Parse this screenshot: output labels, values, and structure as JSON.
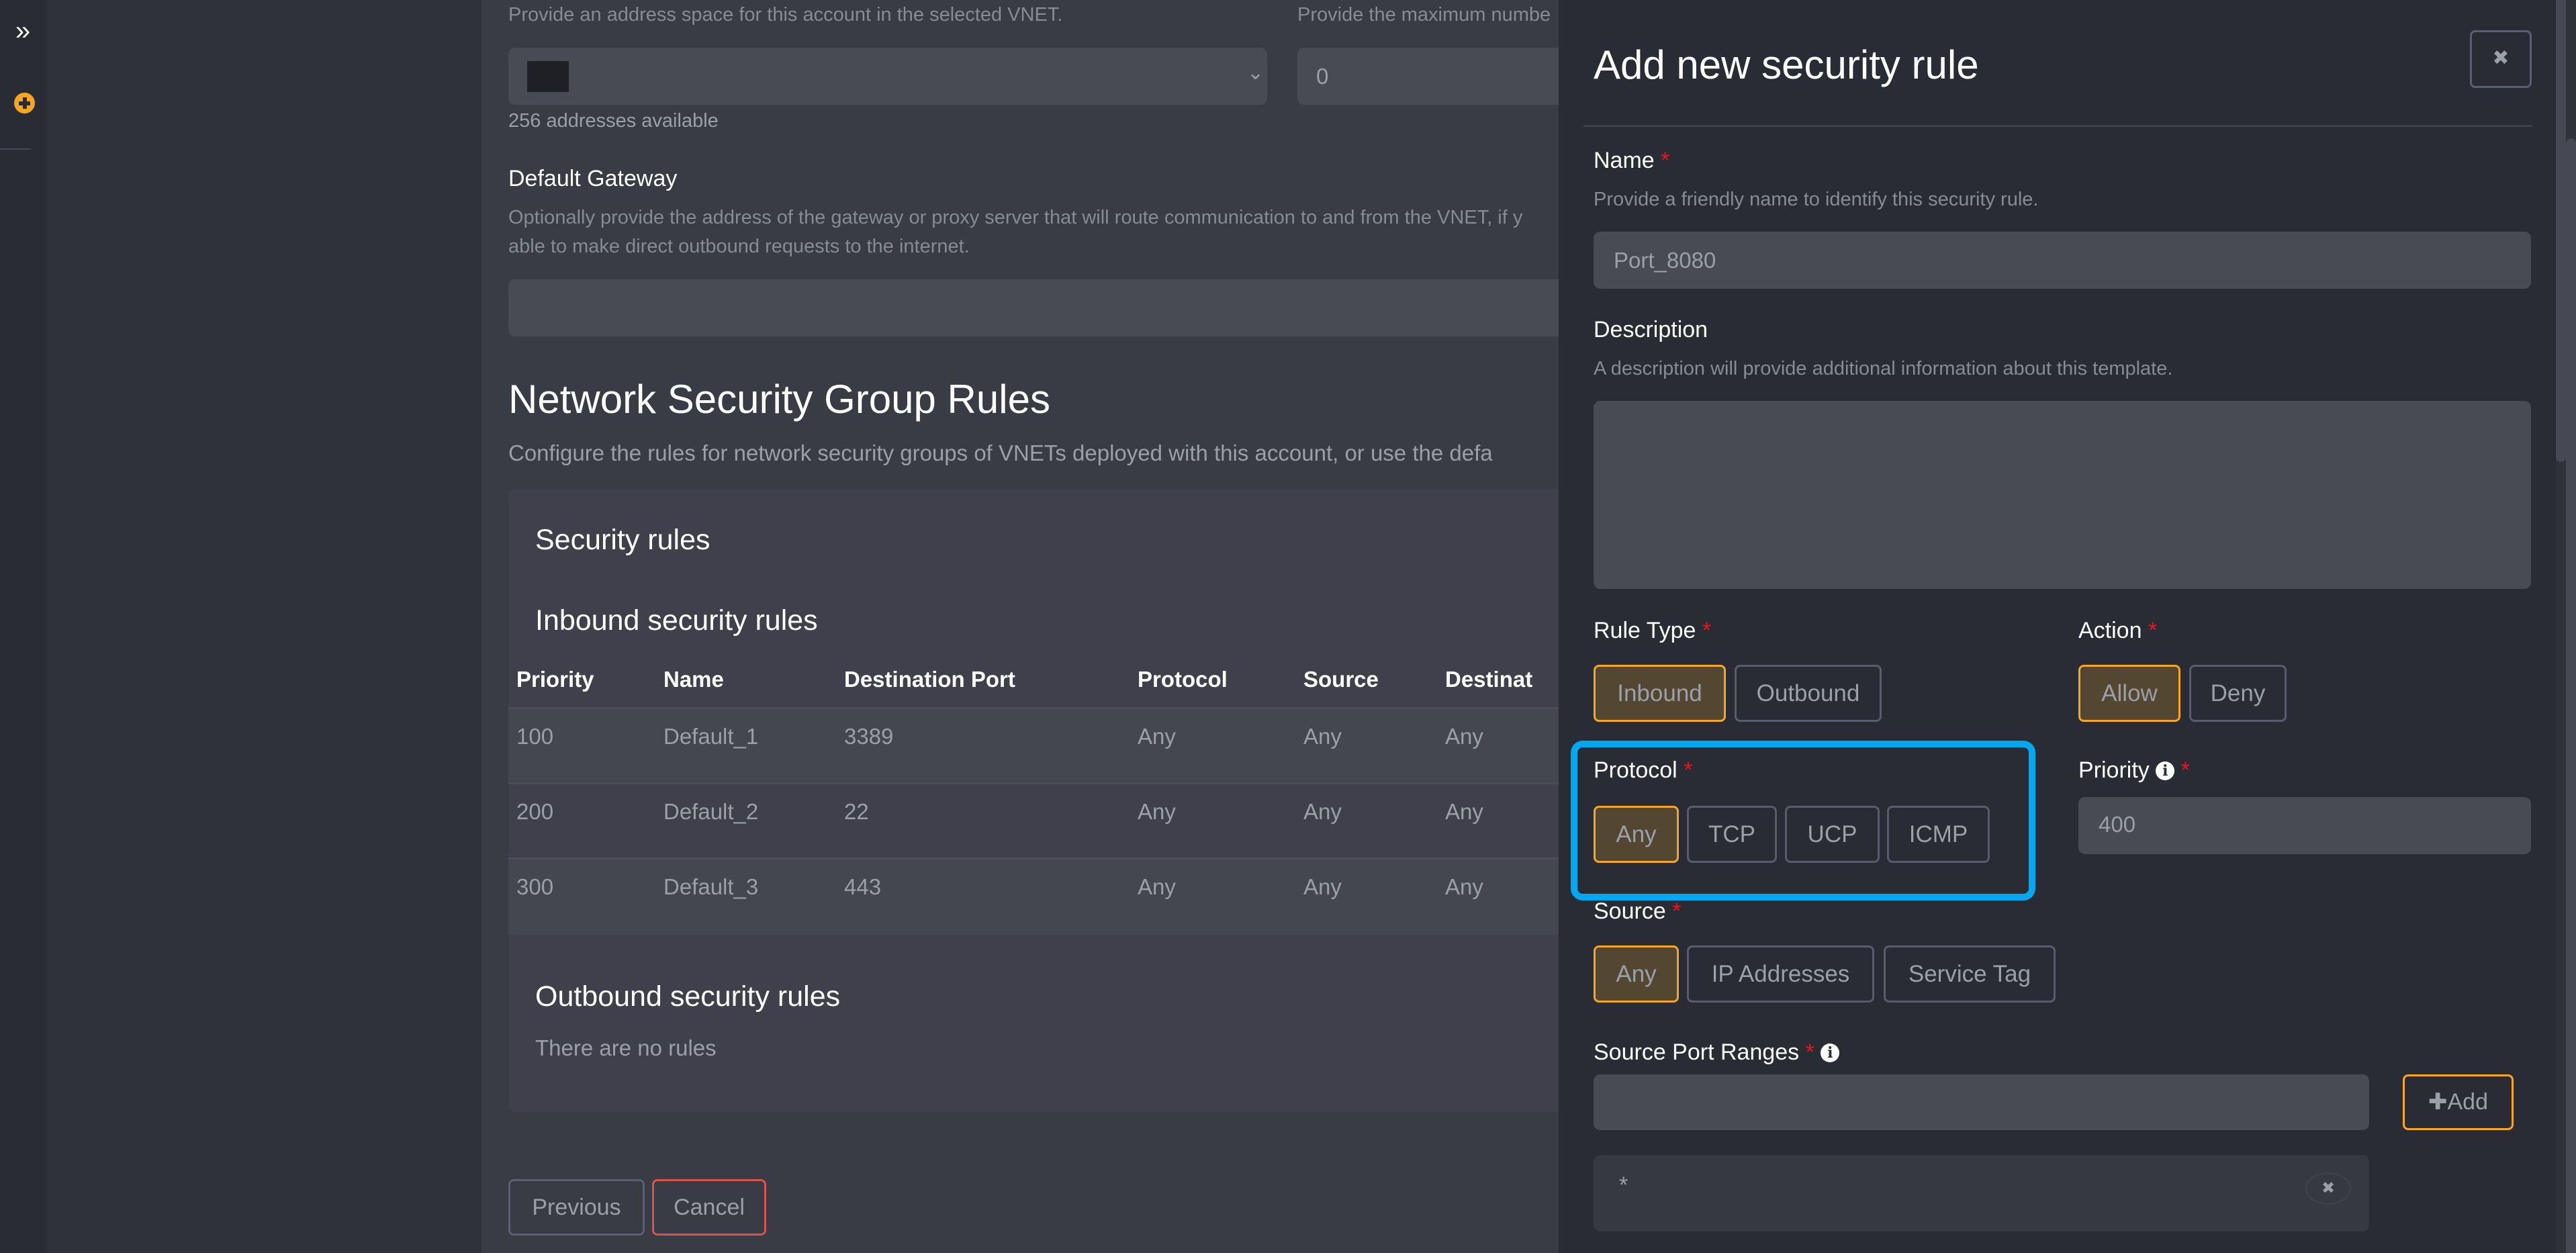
{
  "sidebar": {
    "expand_icon": "double-chevron-right-icon",
    "expand_glyph": "»",
    "add_icon": "plus-circle-icon"
  },
  "main": {
    "address_space_hint": "Provide an address space for this account in the selected VNET.",
    "address_space_value": "",
    "addresses_available": "256 addresses available",
    "max_number_hint": "Provide the maximum numbe",
    "max_number_value": "0",
    "default_gateway_label": "Default Gateway",
    "default_gateway_hint_line1": "Optionally provide the address of the gateway or proxy server that will route communication to and from the VNET, if y",
    "default_gateway_hint_line2": "able to make direct outbound requests to the internet.",
    "default_gateway_value": "",
    "nsg_title": "Network Security Group Rules",
    "nsg_desc": "Configure the rules for network security groups of VNETs deployed with this account, or use the defa",
    "security_rules_title": "Security rules",
    "inbound_title": "Inbound security rules",
    "table_headers": [
      "Priority",
      "Name",
      "Destination Port",
      "Protocol",
      "Source",
      "Destinat"
    ],
    "inbound_rows": [
      {
        "priority": "100",
        "name": "Default_1",
        "port": "3389",
        "protocol": "Any",
        "source": "Any",
        "destination": "Any"
      },
      {
        "priority": "200",
        "name": "Default_2",
        "port": "22",
        "protocol": "Any",
        "source": "Any",
        "destination": "Any"
      },
      {
        "priority": "300",
        "name": "Default_3",
        "port": "443",
        "protocol": "Any",
        "source": "Any",
        "destination": "Any"
      }
    ],
    "outbound_title": "Outbound security rules",
    "outbound_empty": "There are no rules",
    "previous_label": "Previous",
    "cancel_label": "Cancel"
  },
  "drawer": {
    "title": "Add new security rule",
    "close_glyph": "✖",
    "name_label": "Name",
    "name_hint": "Provide a friendly name to identify this security rule.",
    "name_value": "Port_8080",
    "description_label": "Description",
    "description_hint": "A description will provide additional information about this template.",
    "description_value": "",
    "rule_type_label": "Rule Type",
    "rule_type_options": [
      "Inbound",
      "Outbound"
    ],
    "rule_type_selected": "Inbound",
    "action_label": "Action",
    "action_options": [
      "Allow",
      "Deny"
    ],
    "action_selected": "Allow",
    "protocol_label": "Protocol",
    "protocol_options": [
      "Any",
      "TCP",
      "UCP",
      "ICMP"
    ],
    "protocol_selected": "Any",
    "priority_label": "Priority",
    "priority_value": "400",
    "source_label": "Source",
    "source_options": [
      "Any",
      "IP Addresses",
      "Service Tag"
    ],
    "source_selected": "Any",
    "source_port_ranges_label": "Source Port Ranges",
    "source_port_input_value": "",
    "add_label": "Add",
    "add_glyph": "✚",
    "source_port_items": [
      "*"
    ],
    "required_mark": "*",
    "info_glyph": "i",
    "remove_glyph": "✖"
  },
  "colors": {
    "accent": "#f5a623",
    "selected_bg": "#534731",
    "highlight": "#00a8f0",
    "required": "#e8141e",
    "cancel_border": "#d9534f"
  }
}
